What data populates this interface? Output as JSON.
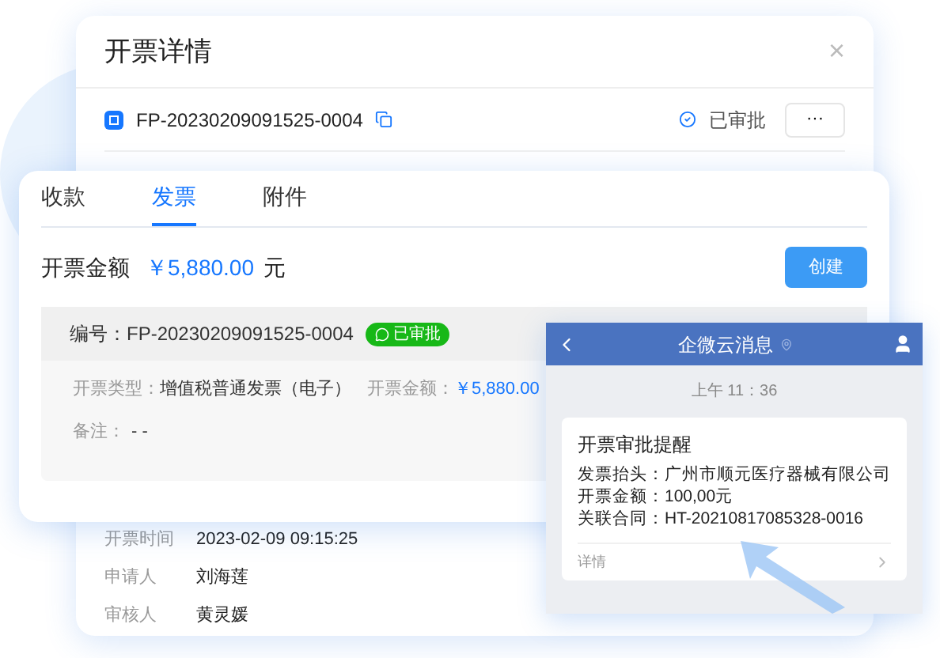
{
  "detail_window": {
    "title": "开票详情",
    "close": "×",
    "invoice_no": "FP-20230209091525-0004",
    "status": "已审批",
    "more": "···",
    "fields": [
      {
        "label": "开票时间",
        "value": "2023-02-09 09:15:25"
      },
      {
        "label": "申请人",
        "value": "刘海莲"
      },
      {
        "label": "审核人",
        "value": "黄灵媛"
      }
    ]
  },
  "tabs_card": {
    "tabs": [
      {
        "label": "收款",
        "selected": false
      },
      {
        "label": "发票",
        "selected": true
      },
      {
        "label": "附件",
        "selected": false
      }
    ],
    "amount_label": "开票金额",
    "amount": "￥5,880.00",
    "unit": "元",
    "create_button": "创建",
    "record": {
      "number": "编号：FP-20230209091525-0004",
      "badge": "已审批",
      "type_label": "开票类型：",
      "type_value": "增值税普通发票（电子）",
      "amount_label": "开票金额：",
      "amount_value": "￥5,880.00",
      "note_label": "备注：",
      "note_value": "- -"
    }
  },
  "message_panel": {
    "title": "企微云消息",
    "time": "上午 11：36",
    "card_title": "开票审批提醒",
    "lines": [
      "发票抬头：广州市顺元医疗器械有限公司",
      "开票金额：100,00元",
      "关联合同：HT-20210817085328-0016"
    ],
    "details": "详情"
  }
}
